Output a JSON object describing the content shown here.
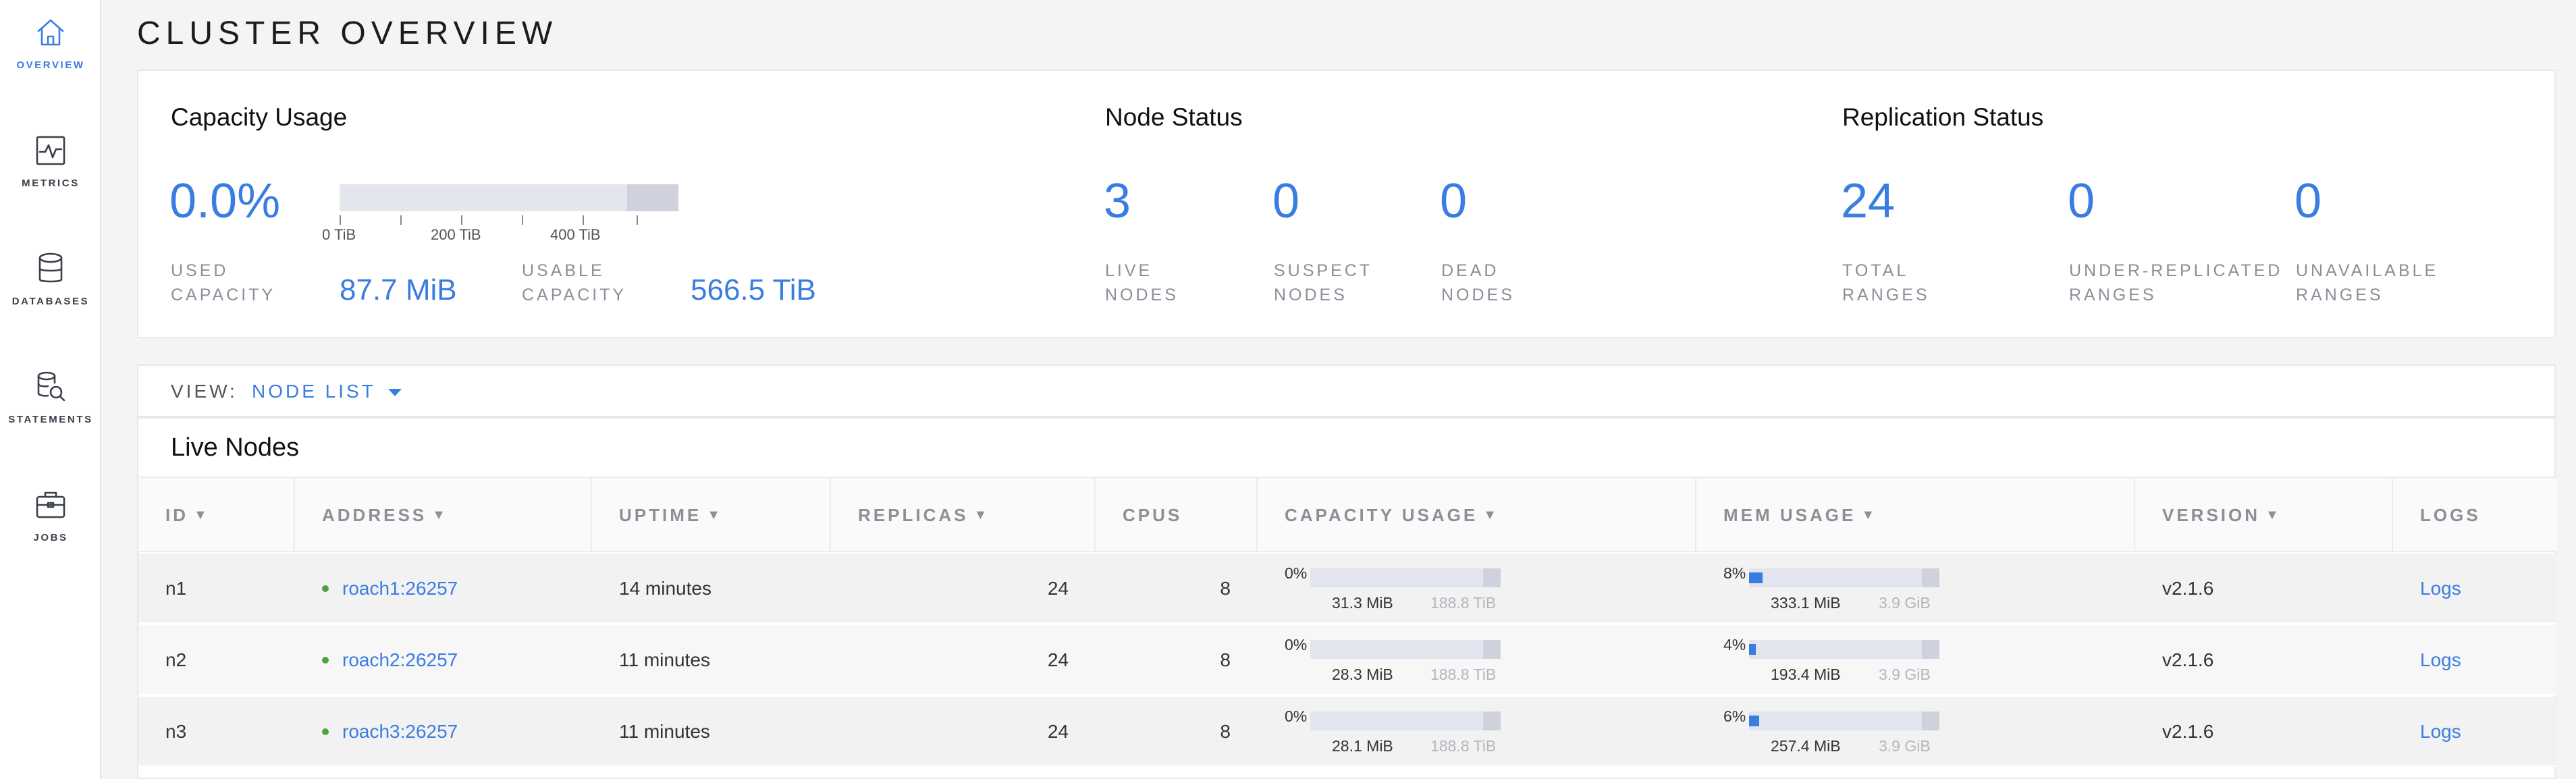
{
  "sidebar": {
    "items": [
      {
        "label": "OVERVIEW",
        "icon": "home-icon",
        "active": true
      },
      {
        "label": "METRICS",
        "icon": "chart-icon",
        "active": false
      },
      {
        "label": "DATABASES",
        "icon": "database-icon",
        "active": false
      },
      {
        "label": "STATEMENTS",
        "icon": "statements-icon",
        "active": false
      },
      {
        "label": "JOBS",
        "icon": "briefcase-icon",
        "active": false
      }
    ]
  },
  "page": {
    "title": "CLUSTER OVERVIEW"
  },
  "capacity": {
    "title": "Capacity Usage",
    "used_percent": "0.0%",
    "used_label_1": "USED",
    "used_label_2": "CAPACITY",
    "used_value": "87.7 MiB",
    "usable_label_1": "USABLE",
    "usable_label_2": "CAPACITY",
    "usable_value": "566.5 TiB",
    "axis_labels": [
      "0 TiB",
      "200 TiB",
      "400 TiB"
    ]
  },
  "node_status": {
    "title": "Node Status",
    "live": "3",
    "live_label_1": "LIVE",
    "live_label_2": "NODES",
    "suspect": "0",
    "suspect_label_1": "SUSPECT",
    "suspect_label_2": "NODES",
    "dead": "0",
    "dead_label_1": "DEAD",
    "dead_label_2": "NODES"
  },
  "replication": {
    "title": "Replication Status",
    "total": "24",
    "total_label_1": "TOTAL",
    "total_label_2": "RANGES",
    "under": "0",
    "under_label_1": "UNDER-REPLICATED",
    "under_label_2": "RANGES",
    "unavailable": "0",
    "unavailable_label_1": "UNAVAILABLE",
    "unavailable_label_2": "RANGES"
  },
  "view": {
    "label": "VIEW:",
    "selected": "NODE LIST"
  },
  "live_nodes": {
    "title": "Live Nodes",
    "columns": [
      "ID",
      "ADDRESS",
      "UPTIME",
      "REPLICAS",
      "CPUS",
      "CAPACITY USAGE",
      "MEM USAGE",
      "VERSION",
      "LOGS"
    ],
    "sort_arrow": "▼",
    "rows": [
      {
        "id": "n1",
        "address": "roach1:26257",
        "uptime": "14 minutes",
        "replicas": "24",
        "cpus": "8",
        "cap_pct": "0%",
        "cap_used": "31.3 MiB",
        "cap_total": "188.8 TiB",
        "cap_fill": 0.0,
        "mem_pct": "8%",
        "mem_used": "333.1 MiB",
        "mem_total": "3.9 GiB",
        "mem_fill": 0.08,
        "version": "v2.1.6",
        "logs": "Logs"
      },
      {
        "id": "n2",
        "address": "roach2:26257",
        "uptime": "11 minutes",
        "replicas": "24",
        "cpus": "8",
        "cap_pct": "0%",
        "cap_used": "28.3 MiB",
        "cap_total": "188.8 TiB",
        "cap_fill": 0.0,
        "mem_pct": "4%",
        "mem_used": "193.4 MiB",
        "mem_total": "3.9 GiB",
        "mem_fill": 0.04,
        "version": "v2.1.6",
        "logs": "Logs"
      },
      {
        "id": "n3",
        "address": "roach3:26257",
        "uptime": "11 minutes",
        "replicas": "24",
        "cpus": "8",
        "cap_pct": "0%",
        "cap_used": "28.1 MiB",
        "cap_total": "188.8 TiB",
        "cap_fill": 0.0,
        "mem_pct": "6%",
        "mem_used": "257.4 MiB",
        "mem_total": "3.9 GiB",
        "mem_fill": 0.06,
        "version": "v2.1.6",
        "logs": "Logs"
      }
    ]
  },
  "colors": {
    "accent": "#3a7de1",
    "live_dot": "#4aa63a"
  }
}
